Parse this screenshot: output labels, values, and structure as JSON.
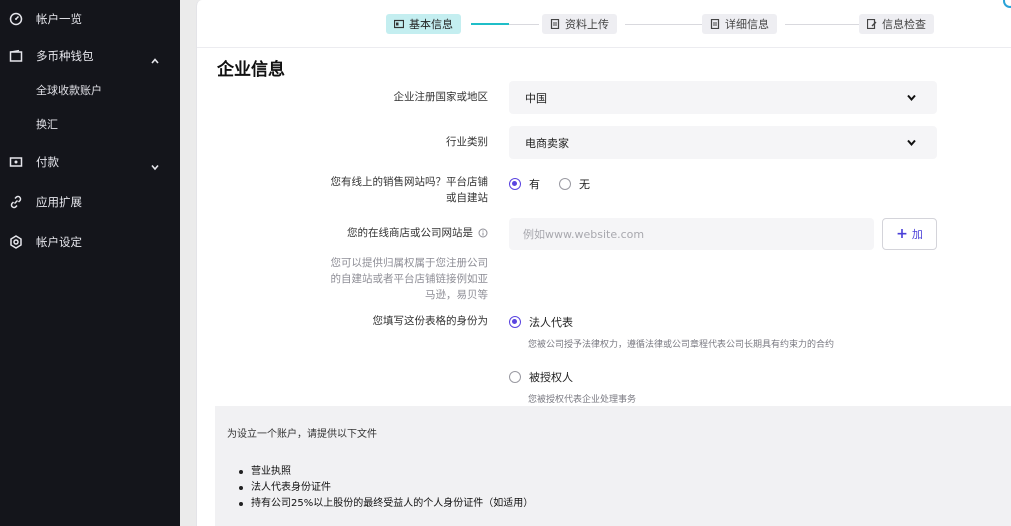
{
  "sidebar": {
    "items": [
      {
        "label": "帐户一览",
        "icon": "dashboard-icon"
      },
      {
        "label": "多币种钱包",
        "icon": "wallet-icon",
        "expanded": true
      },
      {
        "label": "付款",
        "icon": "payment-icon",
        "expanded": false
      },
      {
        "label": "应用扩展",
        "icon": "link-icon"
      },
      {
        "label": "帐户设定",
        "icon": "settings-icon"
      }
    ],
    "wallet_sub": [
      "全球收款账户",
      "换汇"
    ]
  },
  "stepper": {
    "steps": [
      {
        "label": "基本信息",
        "icon": "id-card-icon",
        "active": true
      },
      {
        "label": "资料上传",
        "icon": "document-icon",
        "active": false
      },
      {
        "label": "详细信息",
        "icon": "document-icon",
        "active": false
      },
      {
        "label": "信息检查",
        "icon": "edit-document-icon",
        "active": false
      }
    ]
  },
  "form": {
    "section_title": "企业信息",
    "country": {
      "label": "企业注册国家或地区",
      "value": "中国"
    },
    "industry": {
      "label": "行业类别",
      "value": "电商卖家"
    },
    "has_website": {
      "label_line1": "您有线上的销售网站吗？平台店铺",
      "label_line2": "或自建站",
      "options": [
        "有",
        "无"
      ],
      "selected": "有"
    },
    "website": {
      "label": "您的在线商店或公司网站是",
      "placeholder": "例如www.website.com",
      "add_label": "加",
      "hint_line1": "您可以提供归属权属于您注册公司",
      "hint_line2": "的自建站或者平台店铺链接例如亚",
      "hint_line3": "马逊，易贝等"
    },
    "identity": {
      "label": "您填写这份表格的身份为",
      "options": [
        {
          "label": "法人代表",
          "desc": "您被公司授予法律权力，遵循法律或公司章程代表公司长期具有约束力的合约",
          "checked": true
        },
        {
          "label": "被授权人",
          "desc": "您被授权代表企业处理事务",
          "checked": false
        }
      ]
    }
  },
  "documents": {
    "title": "为设立一个账户，请提供以下文件",
    "items": [
      "营业执照",
      "法人代表身份证件",
      "持有公司25%以上股份的最终受益人的个人身份证件（如适用）"
    ]
  },
  "colors": {
    "sidebar_bg": "#14151b",
    "accent": "#5a44e0",
    "step_active_bg": "#c4eef0",
    "step_line_active": "#1fbec8"
  }
}
